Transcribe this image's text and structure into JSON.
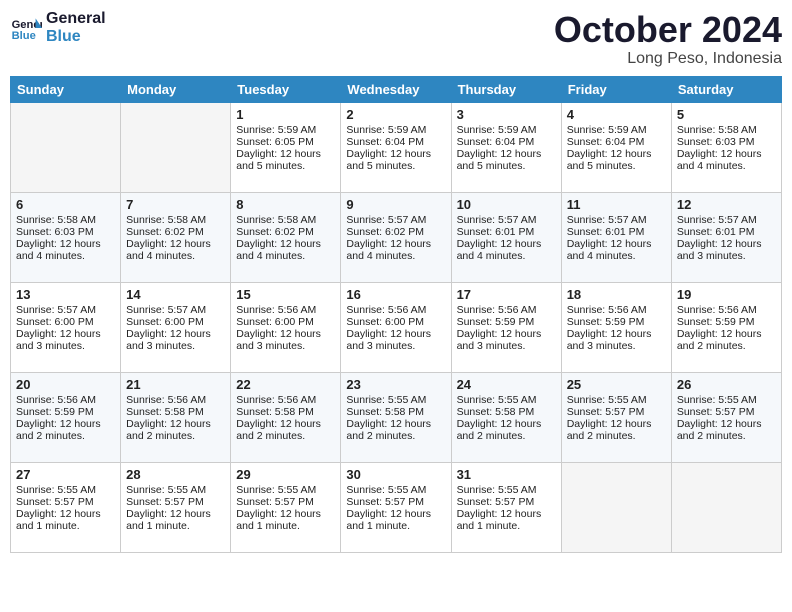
{
  "header": {
    "logo_line1": "General",
    "logo_line2": "Blue",
    "month": "October 2024",
    "location": "Long Peso, Indonesia"
  },
  "days_of_week": [
    "Sunday",
    "Monday",
    "Tuesday",
    "Wednesday",
    "Thursday",
    "Friday",
    "Saturday"
  ],
  "weeks": [
    [
      {
        "day": "",
        "info": ""
      },
      {
        "day": "",
        "info": ""
      },
      {
        "day": "1",
        "info": "Sunrise: 5:59 AM\nSunset: 6:05 PM\nDaylight: 12 hours and 5 minutes."
      },
      {
        "day": "2",
        "info": "Sunrise: 5:59 AM\nSunset: 6:04 PM\nDaylight: 12 hours and 5 minutes."
      },
      {
        "day": "3",
        "info": "Sunrise: 5:59 AM\nSunset: 6:04 PM\nDaylight: 12 hours and 5 minutes."
      },
      {
        "day": "4",
        "info": "Sunrise: 5:59 AM\nSunset: 6:04 PM\nDaylight: 12 hours and 5 minutes."
      },
      {
        "day": "5",
        "info": "Sunrise: 5:58 AM\nSunset: 6:03 PM\nDaylight: 12 hours and 4 minutes."
      }
    ],
    [
      {
        "day": "6",
        "info": "Sunrise: 5:58 AM\nSunset: 6:03 PM\nDaylight: 12 hours and 4 minutes."
      },
      {
        "day": "7",
        "info": "Sunrise: 5:58 AM\nSunset: 6:02 PM\nDaylight: 12 hours and 4 minutes."
      },
      {
        "day": "8",
        "info": "Sunrise: 5:58 AM\nSunset: 6:02 PM\nDaylight: 12 hours and 4 minutes."
      },
      {
        "day": "9",
        "info": "Sunrise: 5:57 AM\nSunset: 6:02 PM\nDaylight: 12 hours and 4 minutes."
      },
      {
        "day": "10",
        "info": "Sunrise: 5:57 AM\nSunset: 6:01 PM\nDaylight: 12 hours and 4 minutes."
      },
      {
        "day": "11",
        "info": "Sunrise: 5:57 AM\nSunset: 6:01 PM\nDaylight: 12 hours and 4 minutes."
      },
      {
        "day": "12",
        "info": "Sunrise: 5:57 AM\nSunset: 6:01 PM\nDaylight: 12 hours and 3 minutes."
      }
    ],
    [
      {
        "day": "13",
        "info": "Sunrise: 5:57 AM\nSunset: 6:00 PM\nDaylight: 12 hours and 3 minutes."
      },
      {
        "day": "14",
        "info": "Sunrise: 5:57 AM\nSunset: 6:00 PM\nDaylight: 12 hours and 3 minutes."
      },
      {
        "day": "15",
        "info": "Sunrise: 5:56 AM\nSunset: 6:00 PM\nDaylight: 12 hours and 3 minutes."
      },
      {
        "day": "16",
        "info": "Sunrise: 5:56 AM\nSunset: 6:00 PM\nDaylight: 12 hours and 3 minutes."
      },
      {
        "day": "17",
        "info": "Sunrise: 5:56 AM\nSunset: 5:59 PM\nDaylight: 12 hours and 3 minutes."
      },
      {
        "day": "18",
        "info": "Sunrise: 5:56 AM\nSunset: 5:59 PM\nDaylight: 12 hours and 3 minutes."
      },
      {
        "day": "19",
        "info": "Sunrise: 5:56 AM\nSunset: 5:59 PM\nDaylight: 12 hours and 2 minutes."
      }
    ],
    [
      {
        "day": "20",
        "info": "Sunrise: 5:56 AM\nSunset: 5:59 PM\nDaylight: 12 hours and 2 minutes."
      },
      {
        "day": "21",
        "info": "Sunrise: 5:56 AM\nSunset: 5:58 PM\nDaylight: 12 hours and 2 minutes."
      },
      {
        "day": "22",
        "info": "Sunrise: 5:56 AM\nSunset: 5:58 PM\nDaylight: 12 hours and 2 minutes."
      },
      {
        "day": "23",
        "info": "Sunrise: 5:55 AM\nSunset: 5:58 PM\nDaylight: 12 hours and 2 minutes."
      },
      {
        "day": "24",
        "info": "Sunrise: 5:55 AM\nSunset: 5:58 PM\nDaylight: 12 hours and 2 minutes."
      },
      {
        "day": "25",
        "info": "Sunrise: 5:55 AM\nSunset: 5:57 PM\nDaylight: 12 hours and 2 minutes."
      },
      {
        "day": "26",
        "info": "Sunrise: 5:55 AM\nSunset: 5:57 PM\nDaylight: 12 hours and 2 minutes."
      }
    ],
    [
      {
        "day": "27",
        "info": "Sunrise: 5:55 AM\nSunset: 5:57 PM\nDaylight: 12 hours and 1 minute."
      },
      {
        "day": "28",
        "info": "Sunrise: 5:55 AM\nSunset: 5:57 PM\nDaylight: 12 hours and 1 minute."
      },
      {
        "day": "29",
        "info": "Sunrise: 5:55 AM\nSunset: 5:57 PM\nDaylight: 12 hours and 1 minute."
      },
      {
        "day": "30",
        "info": "Sunrise: 5:55 AM\nSunset: 5:57 PM\nDaylight: 12 hours and 1 minute."
      },
      {
        "day": "31",
        "info": "Sunrise: 5:55 AM\nSunset: 5:57 PM\nDaylight: 12 hours and 1 minute."
      },
      {
        "day": "",
        "info": ""
      },
      {
        "day": "",
        "info": ""
      }
    ]
  ]
}
